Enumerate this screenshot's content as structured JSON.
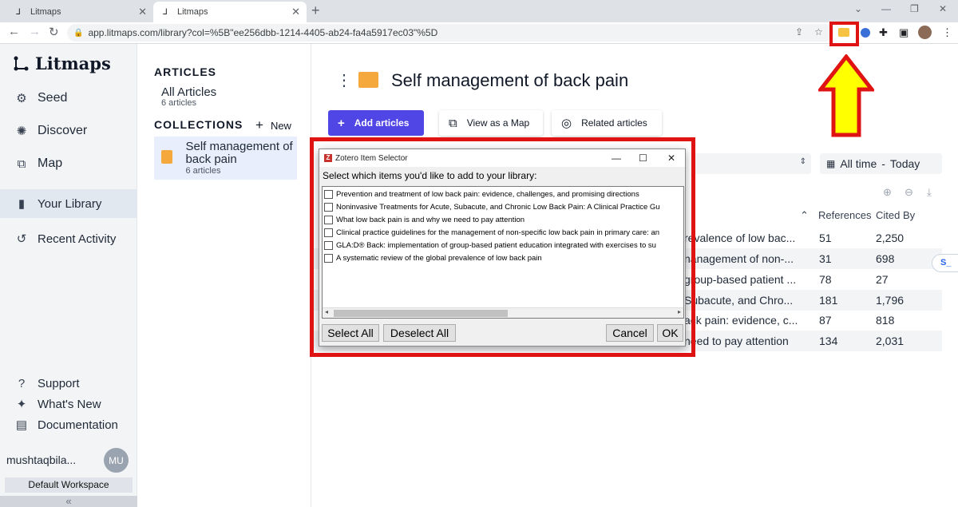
{
  "browser": {
    "tabs": [
      {
        "title": "Litmaps",
        "active": false
      },
      {
        "title": "Litmaps",
        "active": true
      }
    ],
    "url": "app.litmaps.com/library?col=%5B\"ee256dbb-1214-4405-ab24-fa4a5917ec03\"%5D"
  },
  "sidebar": {
    "brand": "Litmaps",
    "nav": [
      {
        "label": "Seed",
        "icon": "seed-icon"
      },
      {
        "label": "Discover",
        "icon": "discover-icon"
      },
      {
        "label": "Map",
        "icon": "map-icon"
      },
      {
        "label": "Your Library",
        "icon": "library-icon",
        "active": true
      },
      {
        "label": "Recent Activity",
        "icon": "history-icon"
      }
    ],
    "footer": [
      {
        "label": "Support",
        "icon": "help-icon"
      },
      {
        "label": "What's New",
        "icon": "sparkle-icon"
      },
      {
        "label": "Documentation",
        "icon": "document-icon"
      }
    ],
    "user": {
      "name": "mushtaqbila...",
      "initials": "MU"
    },
    "workspace": "Default Workspace",
    "collapse": "«"
  },
  "collections": {
    "articles_heading": "ARTICLES",
    "all_articles": "All Articles",
    "all_count": "6 articles",
    "collections_heading": "COLLECTIONS",
    "new_label": "New",
    "items": [
      {
        "name": "Self management of back pain",
        "count": "6 articles"
      }
    ]
  },
  "main": {
    "title": "Self management of back pain",
    "buttons": {
      "add": "Add articles",
      "map": "View as a Map",
      "related": "Related articles"
    },
    "date_filter": {
      "from": "All time",
      "to": "Today"
    },
    "columns": {
      "references": "References",
      "cited_by": "Cited By"
    },
    "rows": [
      {
        "title": "revalence of low bac...",
        "references": "51",
        "cited_by": "2,250"
      },
      {
        "title": "nanagement of non-...",
        "references": "31",
        "cited_by": "698"
      },
      {
        "title": "group-based patient ...",
        "references": "78",
        "cited_by": "27"
      },
      {
        "title": "Subacute, and Chro...",
        "references": "181",
        "cited_by": "1,796"
      },
      {
        "title": "ack pain: evidence, c...",
        "references": "87",
        "cited_by": "818"
      },
      {
        "title": "need to pay attention",
        "references": "134",
        "cited_by": "2,031"
      }
    ],
    "side_tab": "S_"
  },
  "zotero_dialog": {
    "title": "Zotero Item Selector",
    "prompt": "Select which items you'd like to add to your library:",
    "items": [
      "Prevention and treatment of low back pain: evidence, challenges, and promising directions",
      "Noninvasive Treatments for Acute, Subacute, and Chronic Low Back Pain: A Clinical Practice Gu",
      "What low back pain is and why we need to pay attention",
      "Clinical practice guidelines for the management of non-specific low back pain in primary care: an",
      "GLA:D® Back: implementation of group-based patient education integrated with exercises to su",
      "A systematic review of the global prevalence of low back pain"
    ],
    "buttons": {
      "select_all": "Select All",
      "deselect_all": "Deselect All",
      "cancel": "Cancel",
      "ok": "OK"
    }
  },
  "annotations": {
    "highlight_color": "#e01313",
    "arrow_color": "#ffff00"
  },
  "colors": {
    "accent": "#4f46e5",
    "folder": "#f5a83b"
  }
}
